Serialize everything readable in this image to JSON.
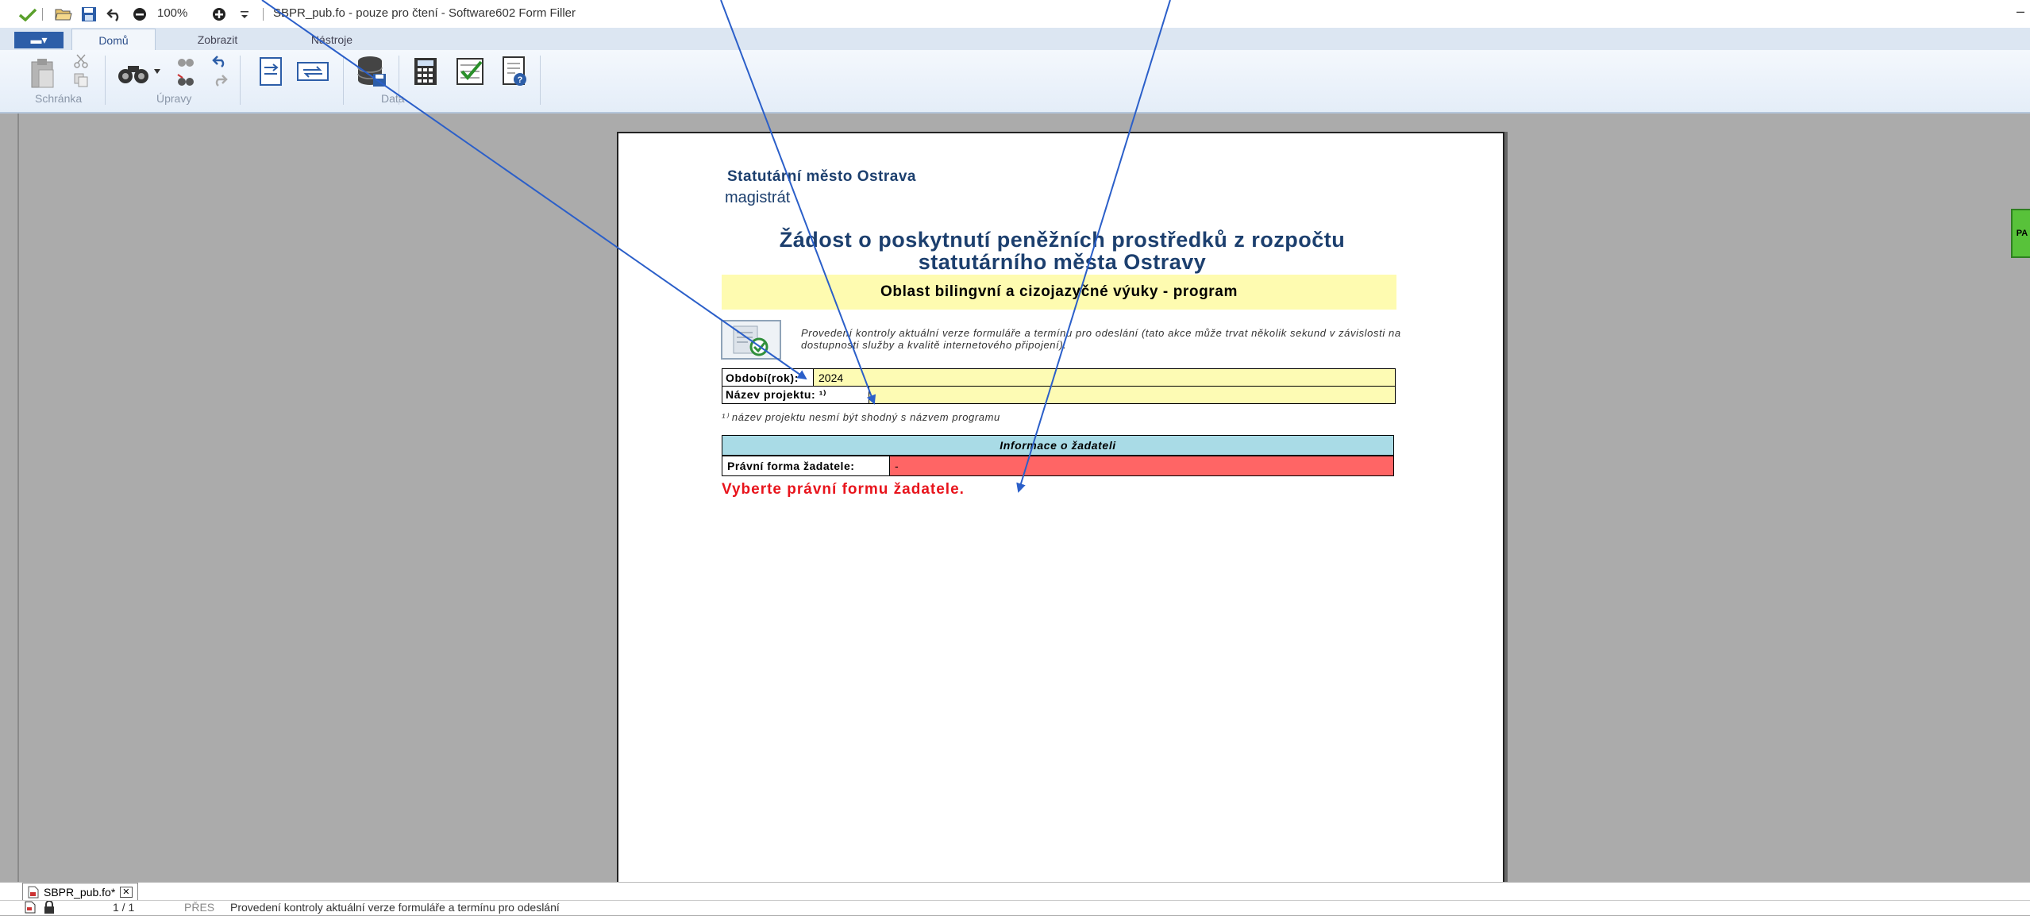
{
  "titlebar": {
    "zoom": "100%",
    "title": "SBPR_pub.fo - pouze pro čtení - Software602 Form Filler",
    "minimize": "–"
  },
  "ribbon": {
    "file_label": "▬▾",
    "tabs": [
      {
        "label": "Domů",
        "active": true
      },
      {
        "label": "Zobrazit",
        "active": false
      },
      {
        "label": "Nástroje",
        "active": false
      }
    ],
    "groups": {
      "clipboard": "Schránka",
      "edit": "Úpravy",
      "data": "Data"
    }
  },
  "document": {
    "org": "Statutární město Ostrava",
    "org_sub": "magistrát",
    "heading_line1": "Žádost o poskytnutí peněžních prostředků z rozpočtu",
    "heading_line2": "statutárního města Ostravy",
    "program": "Oblast bilingvní a cizojazyčné výuky - program",
    "check_note": "Provedení kontroly aktuální verze formuláře a termínu pro odeslání (tato akce může trvat několik sekund v závislosti na dostupnosti služby a kvalitě internetového připojení).",
    "fields": {
      "period_label": "Období(rok):",
      "period_value": "2024",
      "project_label": "Název projektu: ¹⁾",
      "project_value": ""
    },
    "footnote": "¹⁾ název projektu nesmí být shodný s názvem programu",
    "applicant_header": "Informace o žadateli",
    "legal_form_label": "Právní forma žadatele:",
    "legal_form_value": "-",
    "error": "Vyberte právní formu žadatele."
  },
  "side_widget": "PA",
  "doctab": {
    "name": "SBPR_pub.fo*",
    "close": "✕"
  },
  "statusbar": {
    "pages": "1 / 1",
    "mode": "PŘES",
    "message": "Provedení kontroly aktuální verze formuláře a termínu pro odeslání"
  },
  "colors": {
    "arrow": "#2b5fc9",
    "error": "#e8141c",
    "field_yellow": "#fdfbb4",
    "info_header": "#a9dbe6",
    "invalid_red": "#ff6565"
  }
}
